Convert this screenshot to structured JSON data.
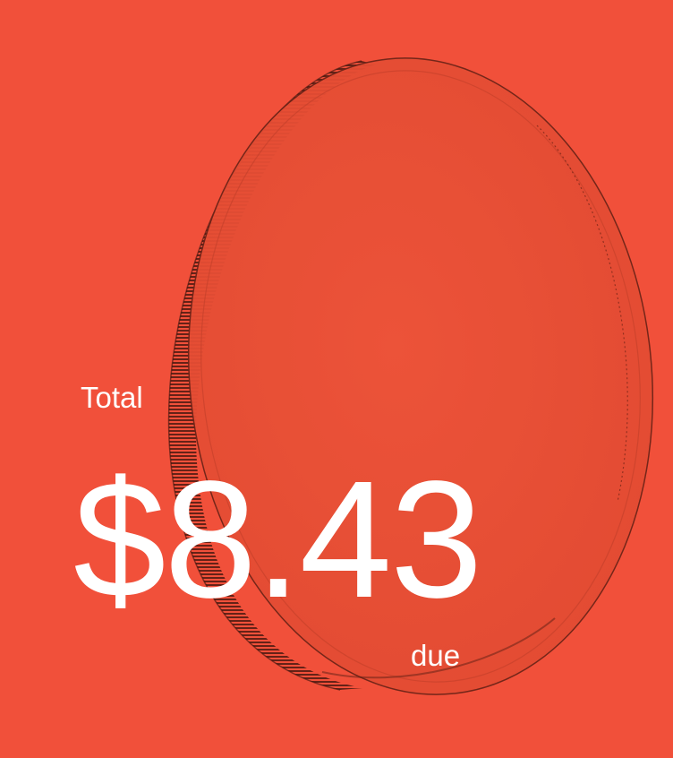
{
  "theme": {
    "background": "#f1503a",
    "coin_face": "#ea5238",
    "coin_edge": "#4a1a12",
    "text": "#ffffff"
  },
  "illustration": {
    "icon": "coin-icon"
  },
  "summary": {
    "total_label": "Total",
    "amount": "$8.43",
    "due_label": "due"
  }
}
